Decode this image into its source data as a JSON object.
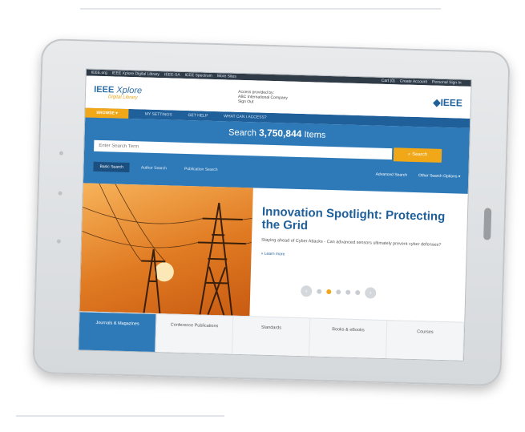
{
  "util_bar": {
    "left_items": [
      "IEEE.org",
      "IEEE Xplore Digital Library",
      "IEEE-SA",
      "IEEE Spectrum",
      "More Sites"
    ],
    "right_items": [
      "Cart (0)",
      "Create Account",
      "Personal Sign In"
    ]
  },
  "header": {
    "logo_main": "IEEE",
    "logo_sub": "Xplore",
    "logo_tag": "Digital Library",
    "access_line1": "Access provided by:",
    "access_line2": "ABC International Company",
    "access_line3": "Sign Out",
    "brand": "IEEE"
  },
  "nav": {
    "browse_label": "BROWSE",
    "items": [
      "MY SETTINGS",
      "GET HELP",
      "WHAT CAN I ACCESS?"
    ]
  },
  "search": {
    "title_prefix": "Search",
    "count": "3,750,844",
    "title_suffix": "Items",
    "placeholder": "Enter Search Term",
    "button_label": "Search",
    "scopes": [
      "Basic Search",
      "Author Search",
      "Publication Search"
    ],
    "advanced": "Advanced Search",
    "other_options": "Other Search Options"
  },
  "hero": {
    "title": "Innovation Spotlight: Protecting the Grid",
    "description": "Staying ahead of Cyber Attacks - Can advanced sensors ultimately prevent cyber defenses?",
    "link": "Learn more"
  },
  "carousel": {
    "slides": 5,
    "active": 1
  },
  "bottom_tabs": [
    "Journals & Magazines",
    "Conference Publications",
    "Standards",
    "Books & eBooks",
    "Courses"
  ]
}
